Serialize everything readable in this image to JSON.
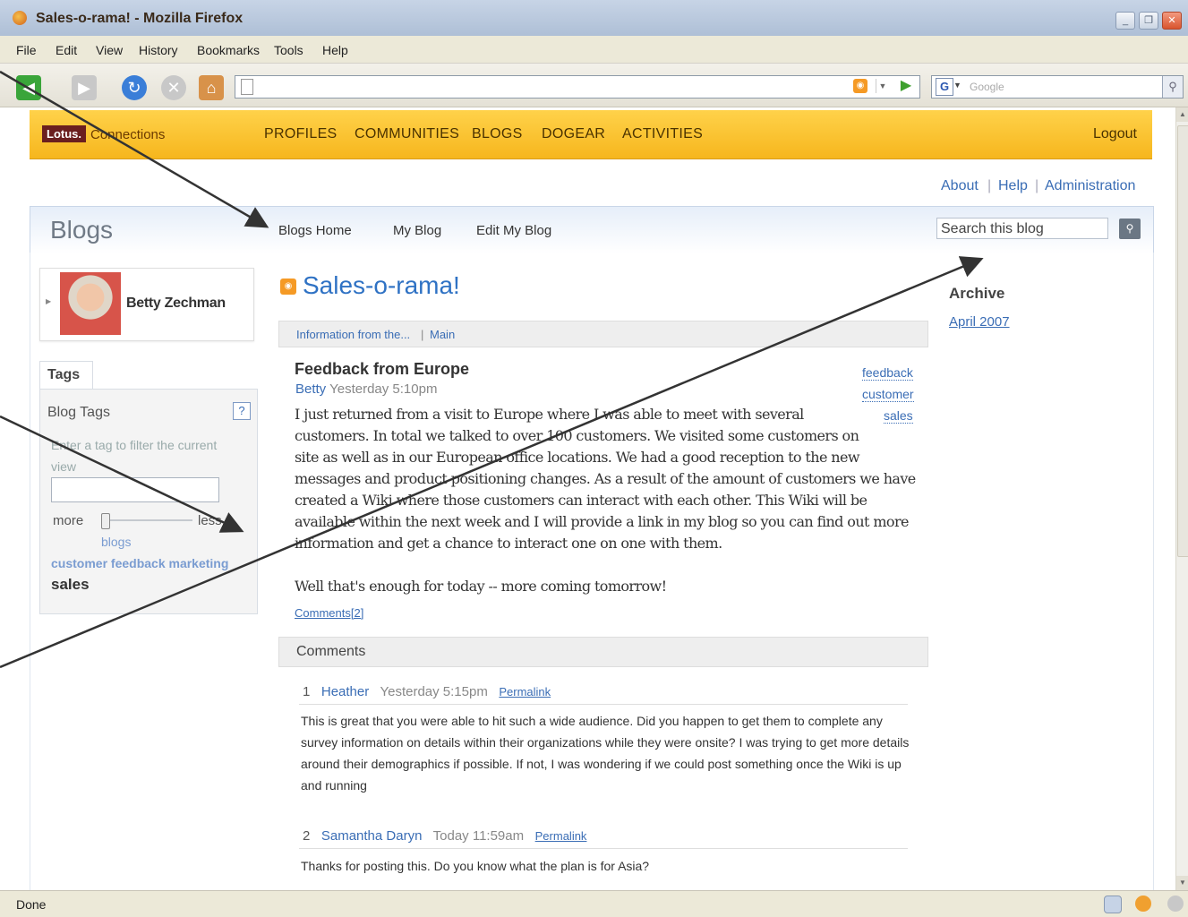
{
  "window": {
    "title": "Sales-o-rama! - Mozilla Firefox",
    "status": "Done"
  },
  "menu": [
    "File",
    "Edit",
    "View",
    "History",
    "Bookmarks",
    "Tools",
    "Help"
  ],
  "browser": {
    "url": "",
    "search_placeholder": "Google"
  },
  "app": {
    "logo_brand": "Lotus.",
    "logo_product": "Connections",
    "nav": [
      "PROFILES",
      "COMMUNITIES",
      "BLOGS",
      "DOGEAR",
      "ACTIVITIES"
    ],
    "logout": "Logout",
    "util_links": [
      "About",
      "Help",
      "Administration"
    ]
  },
  "blogs": {
    "title": "Blogs",
    "tabs": [
      "Blogs Home",
      "My Blog",
      "Edit My Blog"
    ],
    "search_placeholder": "Search this blog"
  },
  "profile": {
    "name": "Betty Zechman"
  },
  "tags": {
    "tab": "Tags",
    "heading": "Blog Tags",
    "help": "?",
    "hint": "Enter a tag to filter the current view",
    "more": "more",
    "less": "less",
    "cloud": [
      "blogs",
      "customer feedback marketing",
      "sales"
    ]
  },
  "blog": {
    "name": "Sales-o-rama!",
    "breadcrumb": [
      "Information from the...",
      "Main"
    ],
    "post": {
      "title": "Feedback from Europe",
      "author": "Betty",
      "time": "Yesterday 5:10pm",
      "tags": [
        "feedback",
        "customer",
        "sales"
      ],
      "paragraphs": [
        "I just returned from a visit to Europe where I was able to meet with several customers.  In total we talked to over 100 customers.  We visited some customers on site as well as in our European office locations.  We had a good reception to the new messages and product positioning changes.  As a result of the amount of customers we have created a Wiki where those customers can interact with each other.  This Wiki will be available within the next week and I will provide a link in my blog so you can find out more information and get a chance to interact one on one with them.",
        "Well that's enough for today -- more coming tomorrow!"
      ],
      "comments_link": "Comments[2]"
    },
    "comments_heading": "Comments",
    "comments": [
      {
        "num": "1",
        "author": "Heather",
        "time": "Yesterday 5:15pm",
        "permalink": "Permalink",
        "text": "This is great that you were able to hit such a wide audience. Did you happen to get them to complete any survey information on details within their organizations while they were onsite? I was trying to get more details around their demographics if possible. If not, I was wondering if we could post something once the Wiki is up and running"
      },
      {
        "num": "2",
        "author": "Samantha Daryn",
        "time": "Today 11:59am",
        "permalink": "Permalink",
        "text": "Thanks for posting this. Do you know what the plan is for Asia?"
      }
    ]
  },
  "archive": {
    "heading": "Archive",
    "months": [
      "April 2007"
    ]
  }
}
